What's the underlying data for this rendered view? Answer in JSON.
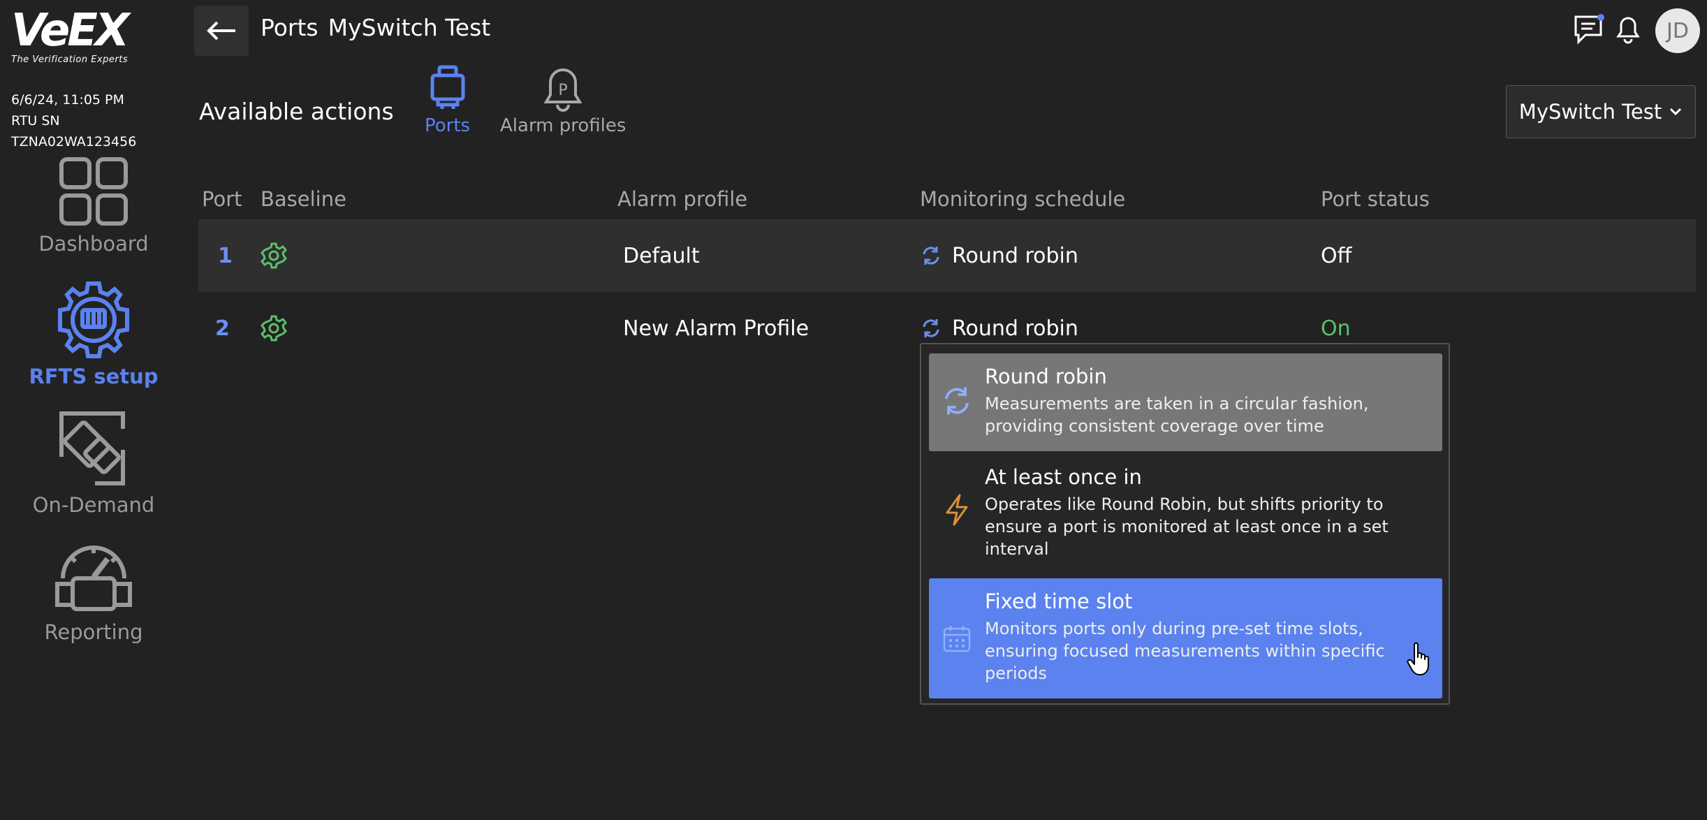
{
  "brand": {
    "logo_text": "VeEX",
    "tagline": "The Verification Experts"
  },
  "status": {
    "datetime": "6/6/24, 11:05 PM",
    "serial": "RTU SN TZNA02WA123456"
  },
  "nav": {
    "dashboard": "Dashboard",
    "rfts_setup": "RFTS setup",
    "on_demand": "On-Demand",
    "reporting": "Reporting"
  },
  "header": {
    "section": "Ports",
    "title": "MySwitch Test",
    "avatar_initials": "JD"
  },
  "actions": {
    "label": "Available actions",
    "ports": "Ports",
    "alarm_profiles": "Alarm profiles"
  },
  "switch_selector": {
    "value": "MySwitch Test"
  },
  "table": {
    "headers": {
      "port": "Port",
      "baseline": "Baseline",
      "alarm_profile": "Alarm profile",
      "schedule": "Monitoring schedule",
      "status": "Port status"
    },
    "rows": [
      {
        "port": "1",
        "alarm_profile": "Default",
        "schedule": "Round robin",
        "status": "Off"
      },
      {
        "port": "2",
        "alarm_profile": "New Alarm Profile",
        "schedule": "Round robin",
        "status": "On"
      }
    ]
  },
  "schedule_options": [
    {
      "title": "Round robin",
      "description": "Measurements are taken in a circular fashion, providing consistent coverage over time"
    },
    {
      "title": "At least once in",
      "description": "Operates like Round Robin, but shifts priority to ensure a port is monitored at least once in a set interval"
    },
    {
      "title": "Fixed time slot",
      "description": "Monitors ports only during pre-set time slots, ensuring focused measurements within specific periods"
    }
  ],
  "colors": {
    "accent": "#5b82ee",
    "status_on": "#5cc06a",
    "highlight_option": "#777777",
    "background": "#222222"
  },
  "icons": {
    "back": "arrow-left-icon",
    "messages": "chat-icon",
    "notifications": "bell-icon",
    "baseline": "gear-icon",
    "round_robin": "refresh-icon",
    "at_least_once": "lightning-icon",
    "fixed_time": "calendar-icon",
    "cursor": "hand-pointer-icon"
  }
}
